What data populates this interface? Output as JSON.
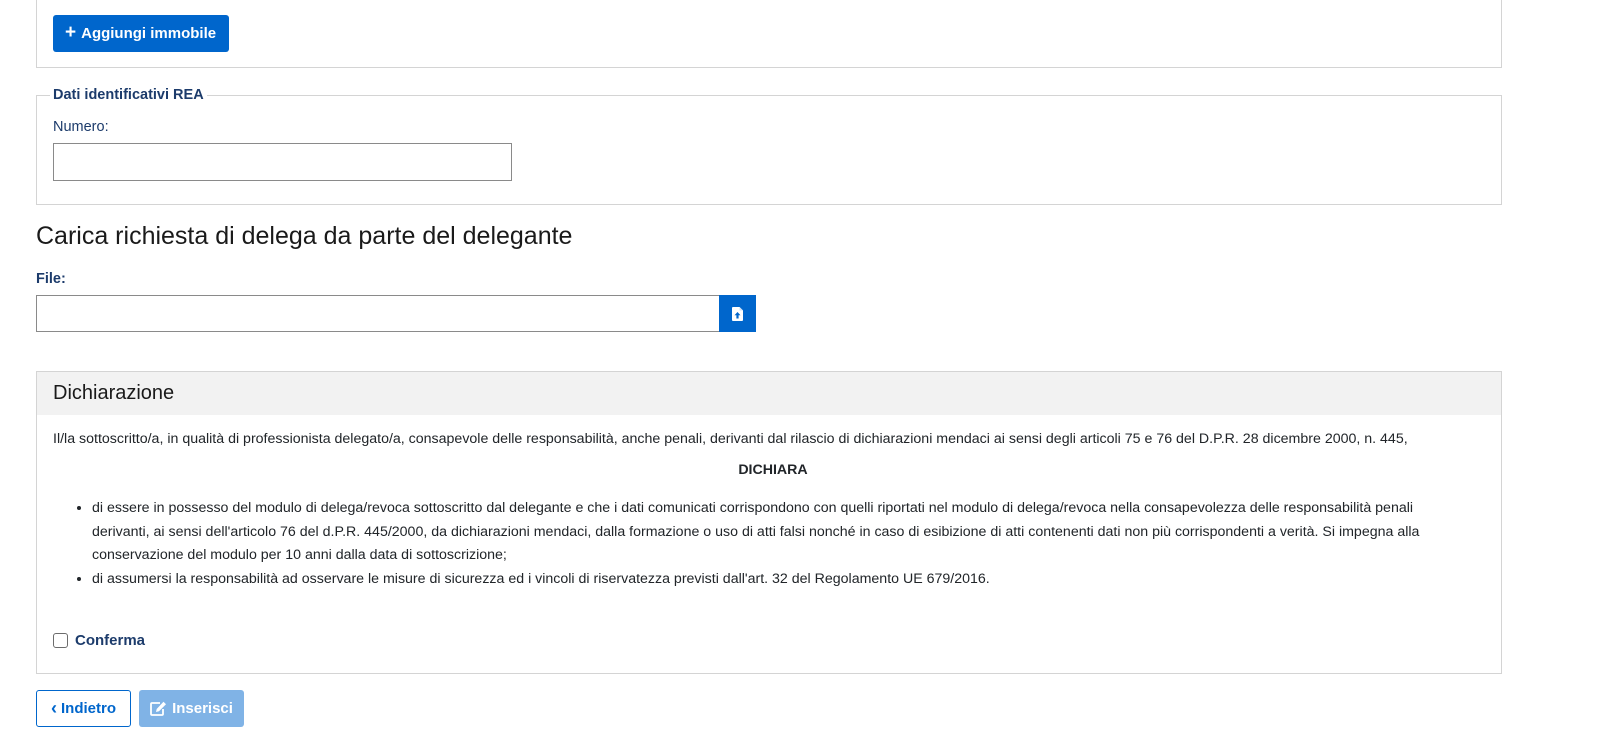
{
  "top_card": {
    "add_property_button": {
      "label": "Aggiungi immobile",
      "icon": "plus-icon"
    }
  },
  "rea_section": {
    "legend": "Dati identificativi REA",
    "numero_label": "Numero:",
    "numero_value": ""
  },
  "upload_section": {
    "title": "Carica richiesta di delega da parte del delegante",
    "file_label": "File:",
    "file_value": "",
    "upload_icon": "file-upload-icon"
  },
  "declaration": {
    "title": "Dichiarazione",
    "intro": "Il/la sottoscritto/a, in qualità di professionista delegato/a, consapevole delle responsabilità, anche penali, derivanti dal rilascio di dichiarazioni mendaci ai sensi degli articoli 75 e 76 del D.P.R. 28 dicembre 2000, n. 445,",
    "heading": "DICHIARA",
    "items": [
      "di essere in possesso del modulo di delega/revoca sottoscritto dal delegante e che i dati comunicati corrispondono con quelli riportati nel modulo di delega/revoca nella consapevolezza delle responsabilità penali derivanti, ai sensi dell'articolo 76 del d.P.R. 445/2000, da dichiarazioni mendaci, dalla formazione o uso di atti falsi nonché in caso di esibizione di atti contenenti dati non più corrispondenti a verità. Si impegna alla conservazione del modulo per 10 anni dalla data di sottoscrizione;",
      "di assumersi la responsabilità ad osservare le misure di sicurezza ed i vincoli di riservatezza previsti dall'art. 32 del Regolamento UE 679/2016."
    ],
    "confirm_label": "Conferma",
    "confirm_checked": false
  },
  "actions": {
    "back_label": "Indietro",
    "insert_label": "Inserisci",
    "insert_enabled": false
  },
  "colors": {
    "primary": "#0066cc",
    "primary_disabled": "#80b3e6",
    "label_text": "#1c3b6b",
    "border": "#d4d4d4",
    "header_bg": "#f2f2f2"
  }
}
